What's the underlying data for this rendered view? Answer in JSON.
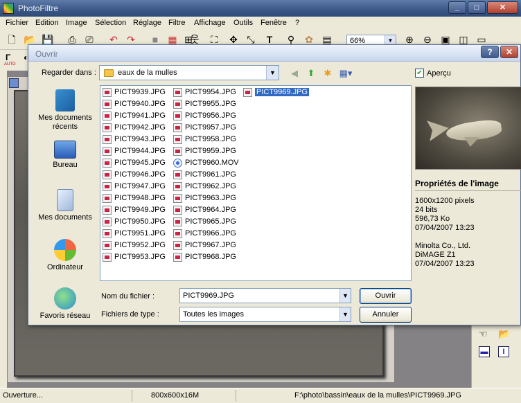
{
  "app": {
    "title": "PhotoFiltre",
    "window_buttons": [
      "_",
      "□",
      "✕"
    ]
  },
  "menu": [
    "Fichier",
    "Edition",
    "Image",
    "Sélection",
    "Réglage",
    "Filtre",
    "Affichage",
    "Outils",
    "Fenêtre",
    "?"
  ],
  "toolbar": {
    "zoom_value": "66%",
    "icons": [
      "new-icon",
      "open-icon",
      "save-icon",
      "print-icon",
      "scan-icon",
      "undo-icon",
      "redo-icon",
      "eraser-icon",
      "palette-icon",
      "grid-icon",
      "person-icon",
      "transform-icon",
      "move-icon",
      "text-icon",
      "stamp-icon",
      "gear-icon",
      "window-icon",
      "zoom-in-icon",
      "zoom-out-icon",
      "fit-icon",
      "fullscreen-icon",
      "screen-icon"
    ]
  },
  "toolbar2": {
    "labels": [
      "AUTO",
      "AUTO"
    ]
  },
  "dialog": {
    "title": "Ouvrir",
    "help_button": "?",
    "close_button": "✕",
    "look_in_label": "Regarder dans :",
    "look_in_value": "eaux de la mulles",
    "preview_checkbox_label": "Aperçu",
    "places": [
      {
        "label": "Mes documents récents",
        "icon": "recent-documents-icon"
      },
      {
        "label": "Bureau",
        "icon": "desktop-icon"
      },
      {
        "label": "Mes documents",
        "icon": "my-documents-icon"
      },
      {
        "label": "Ordinateur",
        "icon": "computer-icon"
      },
      {
        "label": "Favoris réseau",
        "icon": "network-icon"
      }
    ],
    "files_col1": [
      "PICT9939.JPG",
      "PICT9940.JPG",
      "PICT9941.JPG",
      "PICT9942.JPG",
      "PICT9943.JPG",
      "PICT9944.JPG",
      "PICT9945.JPG",
      "PICT9946.JPG",
      "PICT9947.JPG",
      "PICT9948.JPG",
      "PICT9949.JPG",
      "PICT9950.JPG",
      "PICT9951.JPG",
      "PICT9952.JPG",
      "PICT9953.JPG"
    ],
    "files_col2": [
      "PICT9954.JPG",
      "PICT9955.JPG",
      "PICT9956.JPG",
      "PICT9957.JPG",
      "PICT9958.JPG",
      "PICT9959.JPG",
      "PICT9960.MOV",
      "PICT9961.JPG",
      "PICT9962.JPG",
      "PICT9963.JPG",
      "PICT9964.JPG",
      "PICT9965.JPG",
      "PICT9966.JPG",
      "PICT9967.JPG",
      "PICT9968.JPG"
    ],
    "files_col3": [
      "PICT9969.JPG"
    ],
    "selected_file": "PICT9969.JPG",
    "filename_label": "Nom du fichier :",
    "filename_value": "PICT9969.JPG",
    "filetype_label": "Fichiers de type :",
    "filetype_value": "Toutes les images",
    "open_button": "Ouvrir",
    "cancel_button": "Annuler",
    "properties_title": "Propriétés de l'image",
    "properties": [
      "1600x1200 pixels",
      "24 bits",
      "596,73 Ko",
      "07/04/2007 13:23"
    ],
    "exif": [
      "Minolta Co., Ltd.",
      "DiMAGE Z1",
      "07/04/2007 13:23"
    ]
  },
  "status": {
    "left": "Ouverture...",
    "middle": "800x600x16M",
    "path": "F:\\photo\\bassin\\eaux de la mulles\\PICT9969.JPG"
  }
}
